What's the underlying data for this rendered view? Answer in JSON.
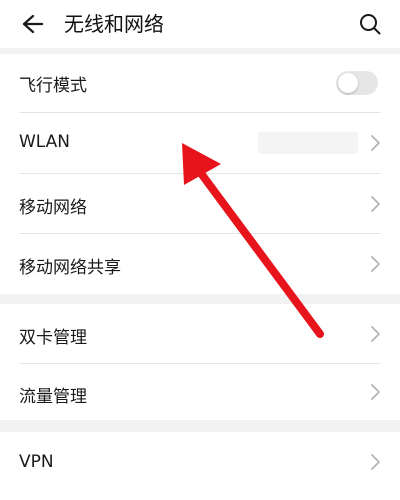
{
  "header": {
    "back_icon": "back-arrow-icon",
    "title": "无线和网络",
    "search_icon": "search-icon"
  },
  "rows": {
    "airplane_mode": {
      "label": "飞行模式",
      "toggle_on": false
    },
    "wlan": {
      "label": "WLAN",
      "chevron_icon": "chevron-right-icon"
    },
    "mobile_network": {
      "label": "移动网络",
      "chevron_icon": "chevron-right-icon"
    },
    "mobile_hotspot": {
      "label": "移动网络共享",
      "chevron_icon": "chevron-right-icon"
    },
    "dual_sim": {
      "label": "双卡管理",
      "chevron_icon": "chevron-right-icon"
    },
    "data_usage": {
      "label": "流量管理",
      "chevron_icon": "chevron-right-icon"
    },
    "vpn": {
      "label": "VPN",
      "chevron_icon": "chevron-right-icon"
    }
  },
  "annotation": {
    "arrow_color": "#e8141b"
  },
  "colors": {
    "background": "#ffffff",
    "group_gap": "#f2f2f2",
    "divider": "#e5e5e5",
    "chevron": "#b3b3b3"
  }
}
